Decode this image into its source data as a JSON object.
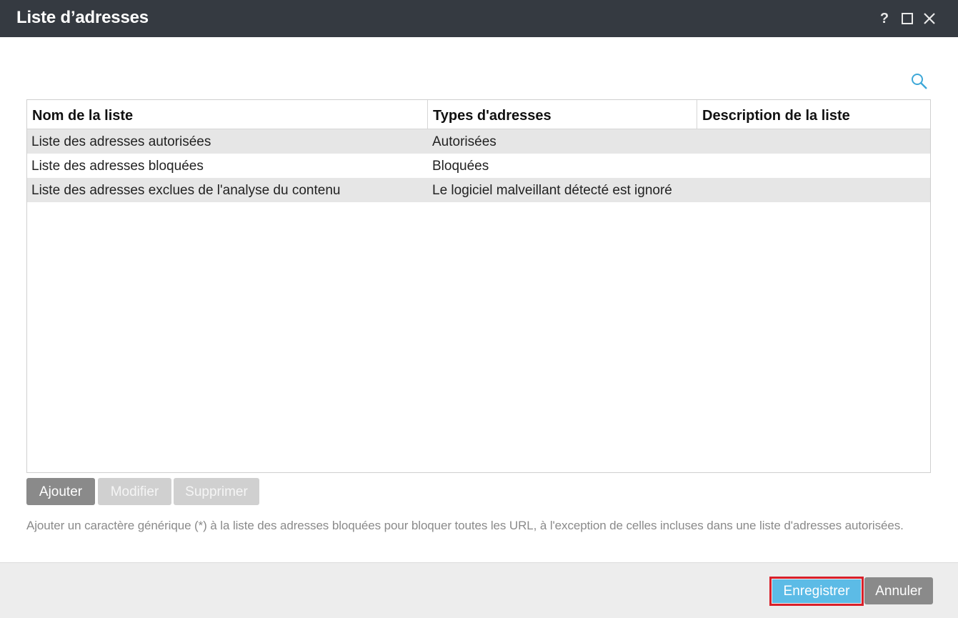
{
  "window": {
    "title": "Liste d’adresses",
    "help_label": "?",
    "icons": {
      "help": "question-icon",
      "maximize": "maximize-icon",
      "close": "close-icon",
      "search": "search-icon"
    }
  },
  "table": {
    "columns": [
      "Nom de la liste",
      "Types d'adresses",
      "Description de la liste"
    ],
    "rows": [
      {
        "name": "Liste des adresses autorisées",
        "type": "Autorisées",
        "description": ""
      },
      {
        "name": "Liste des adresses bloquées",
        "type": "Bloquées",
        "description": ""
      },
      {
        "name": "Liste des adresses exclues de l'analyse du contenu",
        "type": "Le logiciel malveillant détecté est ignoré",
        "description": ""
      }
    ]
  },
  "actions": {
    "add": "Ajouter",
    "edit": "Modifier",
    "delete": "Supprimer"
  },
  "hint": "Ajouter un caractère générique (*) à la liste des adresses bloquées pour bloquer toutes les URL, à l'exception de celles incluses dans une liste d'adresses autorisées.",
  "footer": {
    "save": "Enregistrer",
    "cancel": "Annuler"
  },
  "colors": {
    "titlebar": "#353a41",
    "accent": "#5cbbe6",
    "highlight": "#d9202a",
    "button_gray": "#8a8a8a",
    "row_alt": "#e6e6e6"
  }
}
